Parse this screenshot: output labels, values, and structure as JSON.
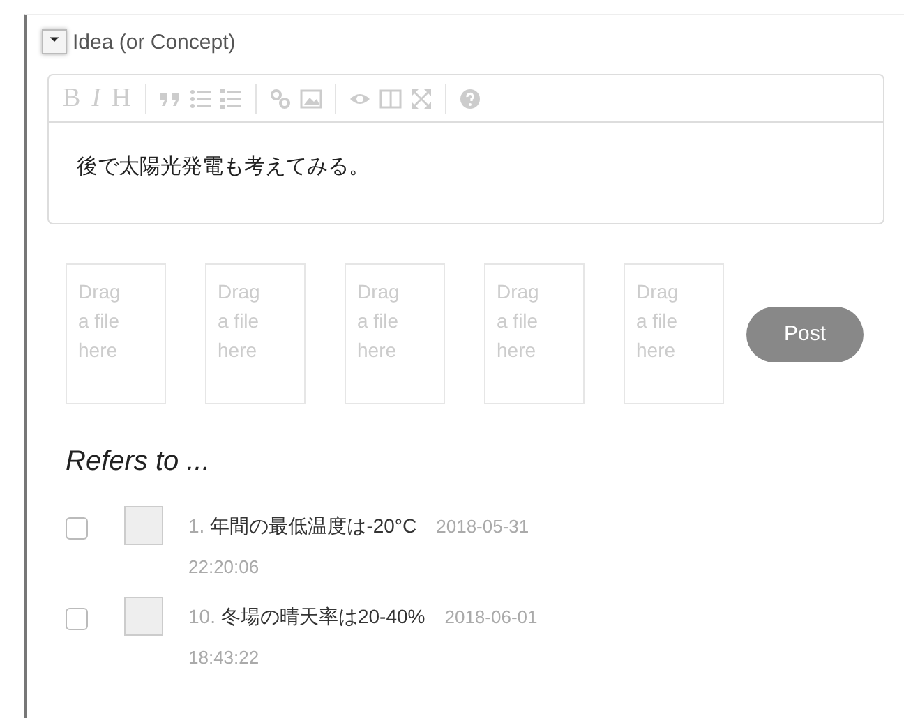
{
  "section": {
    "title": "Idea (or Concept)",
    "expanded": true
  },
  "editor": {
    "format_buttons": [
      "B",
      "I",
      "H"
    ],
    "value": "後で太陽光発電も考えてみる。"
  },
  "drop_zones": [
    "Drag a file here",
    "Drag a file here",
    "Drag a file here",
    "Drag a file here",
    "Drag a file here"
  ],
  "post_button": "Post",
  "refers": {
    "heading": "Refers to ...",
    "items": [
      {
        "checked": false,
        "number": "1.",
        "title": "年間の最低温度は-20°C",
        "date": "2018-05-31",
        "time": "22:20:06"
      },
      {
        "checked": false,
        "number": "10.",
        "title": "冬場の晴天率は20-40%",
        "date": "2018-06-01",
        "time": "18:43:22"
      }
    ]
  }
}
